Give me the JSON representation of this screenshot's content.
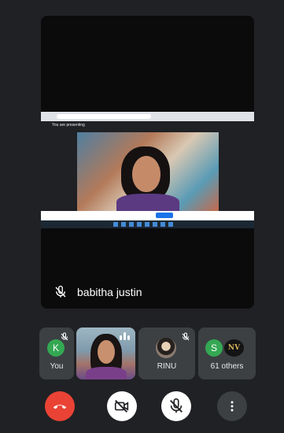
{
  "main_tile": {
    "presenter_name": "babitha justin",
    "share_banner": "You are presenting"
  },
  "participants": [
    {
      "initial": "K",
      "label": "You"
    },
    {
      "label": ""
    },
    {
      "label": "RINU"
    },
    {
      "initial": "S",
      "badge": "NV",
      "label": "61 others"
    }
  ],
  "controls": [
    {
      "icon": "call-end-icon"
    },
    {
      "icon": "camera-off-icon"
    },
    {
      "icon": "mic-off-icon"
    },
    {
      "icon": "more-vert-icon"
    }
  ],
  "colors": {
    "background": "#202124",
    "end_call": "#ea4335",
    "avatar_green": "#34a853"
  }
}
